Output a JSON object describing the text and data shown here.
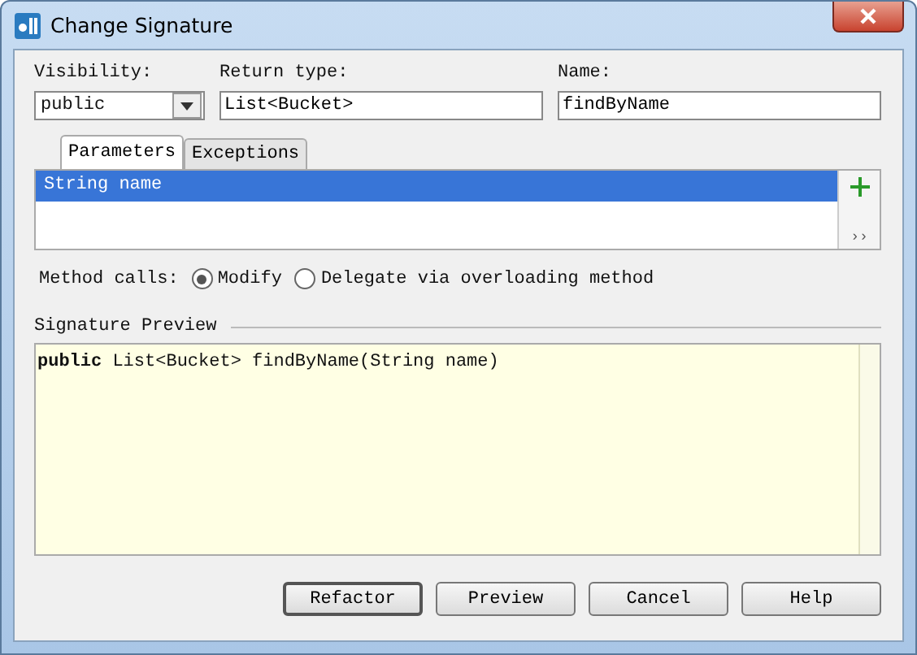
{
  "window": {
    "title": "Change Signature"
  },
  "fields": [
    {
      "label": "Visibility:",
      "value": "public",
      "kind": "combo"
    },
    {
      "label": "Return type:",
      "value": "List<Bucket>",
      "kind": "text"
    },
    {
      "label": "Name:",
      "value": "findByName",
      "kind": "text"
    }
  ],
  "tabs": [
    {
      "label": "Parameters",
      "selected": true
    },
    {
      "label": "Exceptions",
      "selected": false
    }
  ],
  "parameters": [
    {
      "text": "String name",
      "selected": true
    }
  ],
  "side_tools": {
    "more": "››"
  },
  "method_calls": {
    "label": "Method calls:",
    "options": [
      {
        "label": "Modify",
        "selected": true
      },
      {
        "label": "Delegate via overloading method",
        "selected": false
      }
    ]
  },
  "preview": {
    "title": "Signature Preview",
    "code": "**public** List<Bucket> findByName(String name)"
  },
  "buttons": [
    {
      "label": "Refactor",
      "default": true
    },
    {
      "label": "Preview",
      "default": false
    },
    {
      "label": "Cancel",
      "default": false
    },
    {
      "label": "Help",
      "default": false
    }
  ]
}
